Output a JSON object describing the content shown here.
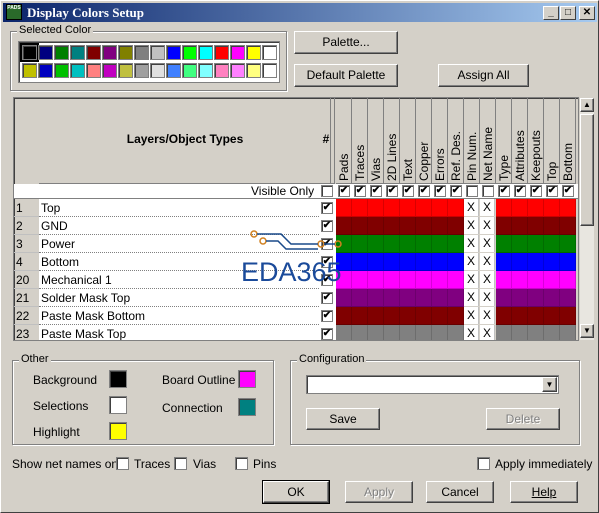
{
  "window": {
    "title": "Display Colors Setup",
    "app_icon_text": "PADS"
  },
  "selected_color": {
    "label": "Selected Color",
    "row1": [
      "#000000",
      "#000080",
      "#008000",
      "#008080",
      "#800000",
      "#800080",
      "#808000",
      "#808080",
      "#c0c0c0",
      "#0000ff",
      "#00ff00",
      "#00ffff",
      "#ff0000",
      "#ff00ff",
      "#ffff00",
      "#ffffff"
    ],
    "row2": [
      "#c0c000",
      "#0000c0",
      "#00c000",
      "#00c0c0",
      "#ff8080",
      "#c000c0",
      "#c0c040",
      "#a0a0a0",
      "#e0e0e0",
      "#4080ff",
      "#40ff80",
      "#80ffff",
      "#ff80c0",
      "#ff80ff",
      "#ffff80",
      "#ffffff"
    ]
  },
  "buttons": {
    "palette": "Palette...",
    "default_palette": "Default Palette",
    "assign_all": "Assign All",
    "save": "Save",
    "delete": "Delete",
    "ok": "OK",
    "apply": "Apply",
    "cancel": "Cancel",
    "help": "Help"
  },
  "grid": {
    "header_title": "Layers/Object Types",
    "hash": "#",
    "visible_only": "Visible Only",
    "columns": [
      "Pads",
      "Traces",
      "Vias",
      "2D Lines",
      "Text",
      "Copper",
      "Errors",
      "Ref. Des.",
      "Pin Num.",
      "Net Name",
      "Type",
      "Attributes",
      "Keepouts",
      "Top",
      "Bottom"
    ],
    "visible_checks": [
      true,
      true,
      true,
      true,
      true,
      true,
      true,
      true,
      false,
      false,
      true,
      true,
      true,
      true,
      true
    ],
    "rows": [
      {
        "num": "1",
        "name": "Top",
        "color": "#ff0000"
      },
      {
        "num": "2",
        "name": "GND",
        "color": "#800000"
      },
      {
        "num": "3",
        "name": "Power",
        "color": "#008000"
      },
      {
        "num": "4",
        "name": "Bottom",
        "color": "#0000ff"
      },
      {
        "num": "20",
        "name": "Mechanical 1",
        "color": "#ff00ff"
      },
      {
        "num": "21",
        "name": "Solder Mask Top",
        "color": "#800080"
      },
      {
        "num": "22",
        "name": "Paste Mask Bottom",
        "color": "#800000"
      },
      {
        "num": "23",
        "name": "Paste Mask Top",
        "color": "#808080"
      }
    ],
    "x_mark": "X"
  },
  "watermark": "EDA365",
  "other": {
    "label": "Other",
    "background": "Background",
    "background_color": "#000000",
    "selections": "Selections",
    "selections_color": "#ffffff",
    "highlight": "Highlight",
    "highlight_color": "#ffff00",
    "board_outline": "Board Outline",
    "board_outline_color": "#ff00ff",
    "connection": "Connection",
    "connection_color": "#008080"
  },
  "configuration": {
    "label": "Configuration",
    "value": ""
  },
  "net_names": {
    "label": "Show net names on",
    "traces": "Traces",
    "vias": "Vias",
    "pins": "Pins"
  },
  "apply_immediately": "Apply immediately"
}
